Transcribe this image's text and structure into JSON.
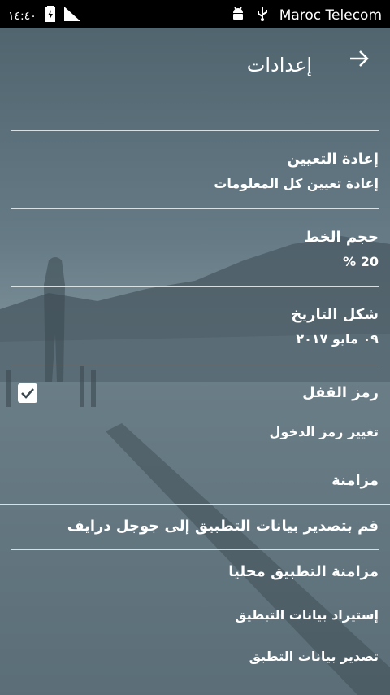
{
  "status_bar": {
    "time": "١٤:٤٠",
    "carrier": "Maroc Telecom",
    "icons": [
      "battery-charging-icon",
      "signal-icon",
      "android-icon",
      "usb-icon"
    ]
  },
  "app_bar": {
    "title": "إعدادات",
    "back_icon": "arrow-right-icon"
  },
  "settings": {
    "reset_title": "إعادة التعيين",
    "reset_sub": "إعادة تعيين كل المعلومات",
    "font_size_title": "حجم الخط",
    "font_size_value": "20 %",
    "date_format_title": "شكل التاريخ",
    "date_format_value": "٠٩ مايو ٢٠١٧",
    "lock_title": "رمز القفل",
    "lock_checked": true,
    "change_pin": "تغيير رمز الدخول",
    "sync_header": "مزامنة",
    "export_drive": "قم بتصدير بيانات التطبيق إلى جوجل درايف",
    "local_sync_header": "مزامنة التطبيق محليا",
    "import_data": "إستيراد بيانات التبطيق",
    "export_data": "تصدير بيانات التطبق"
  }
}
